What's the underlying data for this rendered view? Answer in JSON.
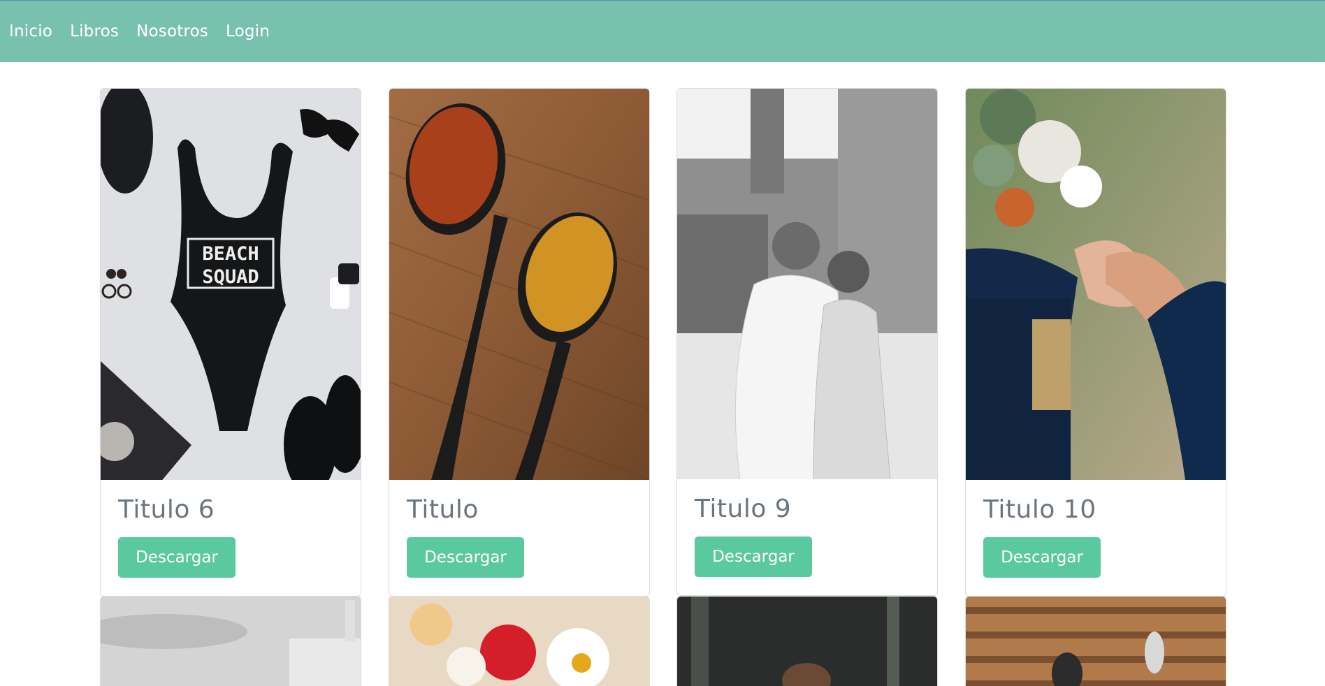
{
  "nav": {
    "items": [
      {
        "label": "Inicio"
      },
      {
        "label": "Libros"
      },
      {
        "label": "Nosotros"
      },
      {
        "label": "Login"
      }
    ]
  },
  "cards": [
    {
      "title": "Titulo 6",
      "button": "Descargar",
      "image": "swimsuit-flatlay-image",
      "image_text_1": "BEACH",
      "image_text_2": "SQUAD"
    },
    {
      "title": "Titulo",
      "button": "Descargar",
      "image": "spice-spoons-image"
    },
    {
      "title": "Titulo 9",
      "button": "Descargar",
      "image": "couple-embrace-image"
    },
    {
      "title": "Titulo 10",
      "button": "Descargar",
      "image": "holding-hands-image"
    }
  ],
  "colors": {
    "navbar": "#78c2ad",
    "button": "#5bc9a0"
  }
}
